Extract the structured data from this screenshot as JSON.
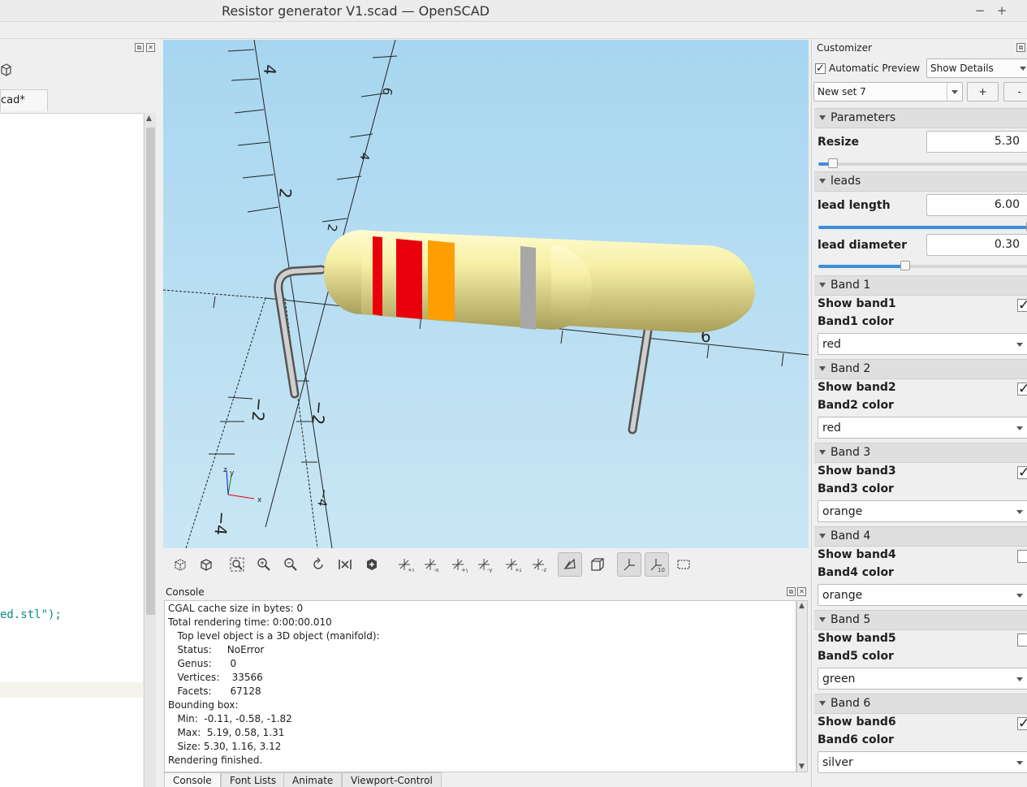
{
  "window": {
    "title": "Resistor generator V1.scad — OpenSCAD",
    "min_label": "−",
    "max_label": "+"
  },
  "editor": {
    "tab_label": "cad*",
    "code_line": "ed.stl\");"
  },
  "viewport": {
    "axis_labels": [
      "4",
      "6",
      "4",
      "2",
      "2",
      "6",
      "−2",
      "−2",
      "−4",
      "−4"
    ]
  },
  "toolbar": {
    "icons": [
      "preview-icon",
      "render-icon",
      "view-all-icon",
      "zoom-in-icon",
      "zoom-out-icon",
      "reset-view-icon",
      "view-center-icon",
      "crosshair-icon",
      "view-right-icon",
      "view-top-icon",
      "view-bottom-icon",
      "view-left-icon",
      "view-front-icon",
      "view-back-icon",
      "perspective-icon",
      "orthogonal-icon",
      "show-axes-icon",
      "show-scale-icon",
      "show-edges-icon"
    ]
  },
  "console": {
    "title": "Console",
    "lines": [
      "CGAL cache size in bytes: 0",
      "Total rendering time: 0:00:00.010",
      "   Top level object is a 3D object (manifold):",
      "   Status:     NoError",
      "   Genus:      0",
      "   Vertices:    33566",
      "   Facets:      67128",
      "Bounding box:",
      "   Min:  -0.11, -0.58, -1.82",
      "   Max:  5.19, 0.58, 1.31",
      "   Size: 5.30, 1.16, 3.12",
      "Rendering finished."
    ],
    "tabs": [
      "Console",
      "Font Lists",
      "Animate",
      "Viewport-Control"
    ]
  },
  "customizer": {
    "title": "Customizer",
    "auto_preview_label": "Automatic Preview",
    "show_details": "Show Details",
    "preset": "New set 7",
    "add_label": "+",
    "remove_label": "-",
    "parameters_label": "Parameters",
    "resize_label": "Resize",
    "resize_value": "5.30",
    "resize_fraction": 0.07,
    "leads_label": "leads",
    "lead_length_label": "lead length",
    "lead_length_value": "6.00",
    "lead_length_fraction": 1.0,
    "lead_diameter_label": "lead diameter",
    "lead_diameter_value": "0.30",
    "lead_diameter_fraction": 0.41,
    "bands": [
      {
        "header": "Band 1",
        "show_label": "Show band1",
        "shown": true,
        "color_label": "Band1 color",
        "color": "red"
      },
      {
        "header": "Band 2",
        "show_label": "Show band2",
        "shown": true,
        "color_label": "Band2 color",
        "color": "red"
      },
      {
        "header": "Band 3",
        "show_label": "Show band3",
        "shown": true,
        "color_label": "Band3 color",
        "color": "orange"
      },
      {
        "header": "Band 4",
        "show_label": "Show band4",
        "shown": false,
        "color_label": "Band4 color",
        "color": "orange"
      },
      {
        "header": "Band 5",
        "show_label": "Show band5",
        "shown": false,
        "color_label": "Band5 color",
        "color": "green"
      },
      {
        "header": "Band 6",
        "show_label": "Show band6",
        "shown": true,
        "color_label": "Band6 color",
        "color": "silver"
      }
    ]
  },
  "colors": {
    "viewport_top": "#a7d6f0",
    "resistor_body": "#f7f0a6",
    "band_red": "#e8000c",
    "band_orange": "#ff9e00",
    "band_silver": "#a8a8a8",
    "lead_gray": "#9a9a9a",
    "accent": "#3c8fd6"
  }
}
